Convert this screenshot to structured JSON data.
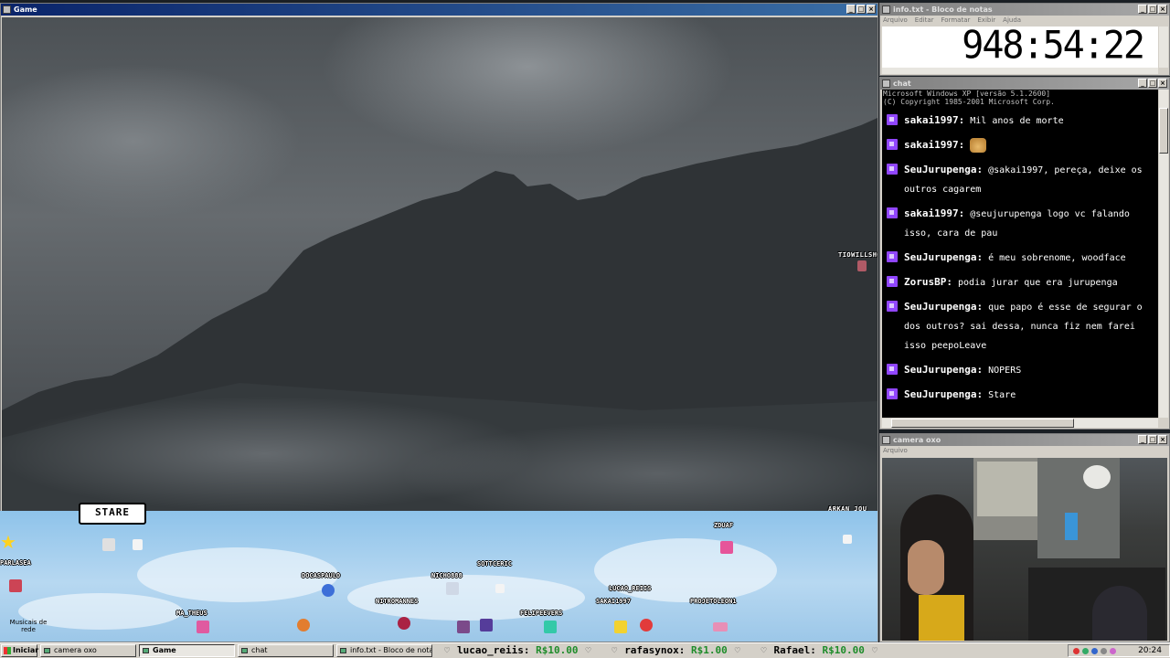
{
  "game_window": {
    "title": "Game",
    "hud_names": [
      "TIOWILLSHOW",
      "ARKAN_JOU"
    ]
  },
  "stream_strip": {
    "bubble_text": "STARE",
    "users": [
      "PARLASEA",
      "ZDUAF",
      "SOTTCERIC",
      "DOCASPAULO",
      "NICHO888",
      "LUCAO_REIIS",
      "SAKAI1997",
      "MA_THEUS",
      "NITROMANNES",
      "FELIPEEVERS",
      "PROJETOLEON1"
    ],
    "corner_label": "Musicais de rede"
  },
  "notepad": {
    "title": "info.txt - Bloco de notas",
    "menu": [
      "Arquivo",
      "Editar",
      "Formatar",
      "Exibir",
      "Ajuda"
    ],
    "timer": "948:54:22"
  },
  "chat_window": {
    "title": "chat",
    "header_lines": [
      "Microsoft Windows XP [versão 5.1.2600]",
      "(C) Copyright 1985-2001 Microsoft Corp."
    ],
    "messages": [
      {
        "user": "sakai1997:",
        "text": "Mil anos de morte"
      },
      {
        "user": "sakai1997:",
        "text": ""
      },
      {
        "user": "SeuJurupenga:",
        "text": "@sakai1997, pereça, deixe os outros cagarem"
      },
      {
        "user": "sakai1997:",
        "text": "@seujurupenga logo vc falando isso, cara de pau"
      },
      {
        "user": "SeuJurupenga:",
        "text": "é meu sobrenome, woodface"
      },
      {
        "user": "ZorusBP:",
        "text": "podia jurar que era jurupenga"
      },
      {
        "user": "SeuJurupenga:",
        "text": "que papo é esse de segurar o dos outros? sai dessa, nunca fiz nem farei isso peepoLeave"
      },
      {
        "user": "SeuJurupenga:",
        "text": "NOPERS"
      },
      {
        "user": "SeuJurupenga:",
        "text": "Stare"
      }
    ]
  },
  "camera_window": {
    "title": "camera oxo",
    "menu": [
      "Arquivo"
    ]
  },
  "taskbar": {
    "start_label": "Iniciar",
    "tasks": [
      "camera oxo",
      "Game",
      "chat",
      "info.txt - Bloco de notas"
    ],
    "ticker": [
      {
        "name": "lucao_reiis:",
        "amount": "R$10.00"
      },
      {
        "name": "rafasynox:",
        "amount": "R$1.00"
      },
      {
        "name": "Rafael:",
        "amount": "R$10.00"
      }
    ],
    "clock": "20:24"
  },
  "colors": {
    "titlebar": "#0a246a",
    "donation": "#1e8c2a",
    "twitch_badge": "#9146ff"
  }
}
